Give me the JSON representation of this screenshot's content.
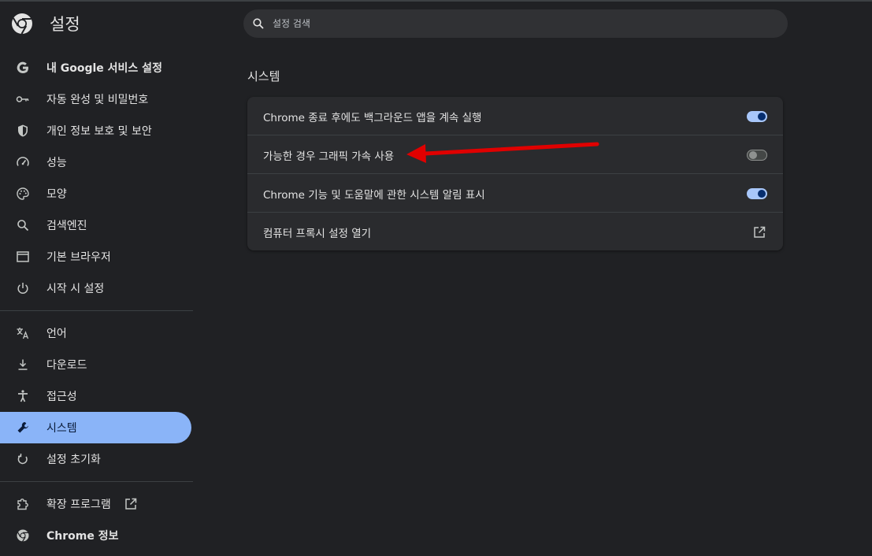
{
  "app": {
    "title": "설정"
  },
  "search": {
    "placeholder": "설정 검색",
    "value": ""
  },
  "sidebar": {
    "items": [
      {
        "label": "내 Google 서비스 설정",
        "icon": "google-g-icon"
      },
      {
        "label": "자동 완성 및 비밀번호",
        "icon": "key-icon"
      },
      {
        "label": "개인 정보 보호 및 보안",
        "icon": "shield-icon"
      },
      {
        "label": "성능",
        "icon": "speedometer-icon"
      },
      {
        "label": "모양",
        "icon": "palette-icon"
      },
      {
        "label": "검색엔진",
        "icon": "search-icon"
      },
      {
        "label": "기본 브라우저",
        "icon": "browser-window-icon"
      },
      {
        "label": "시작 시 설정",
        "icon": "power-icon"
      },
      {
        "label": "언어",
        "icon": "translate-icon"
      },
      {
        "label": "다운로드",
        "icon": "download-icon"
      },
      {
        "label": "접근성",
        "icon": "accessibility-icon"
      },
      {
        "label": "시스템",
        "icon": "wrench-icon",
        "active": true
      },
      {
        "label": "설정 초기화",
        "icon": "reset-icon"
      },
      {
        "label": "확장 프로그램",
        "icon": "puzzle-icon"
      },
      {
        "label": "Chrome 정보",
        "icon": "chrome-icon"
      }
    ]
  },
  "main": {
    "section_title": "시스템",
    "rows": [
      {
        "label": "Chrome 종료 후에도 백그라운드 앱을 계속 실행",
        "control": "toggle",
        "on": true
      },
      {
        "label": "가능한 경우 그래픽 가속 사용",
        "control": "toggle",
        "on": false
      },
      {
        "label": "Chrome 기능 및 도움말에 관한 시스템 알림 표시",
        "control": "toggle",
        "on": true
      },
      {
        "label": "컴퓨터 프록시 설정 열기",
        "control": "external-link"
      }
    ]
  },
  "colors": {
    "accent": "#8ab4f8",
    "annotation_arrow": "#e00000",
    "background": "#202124",
    "card": "#2a2b2e"
  }
}
